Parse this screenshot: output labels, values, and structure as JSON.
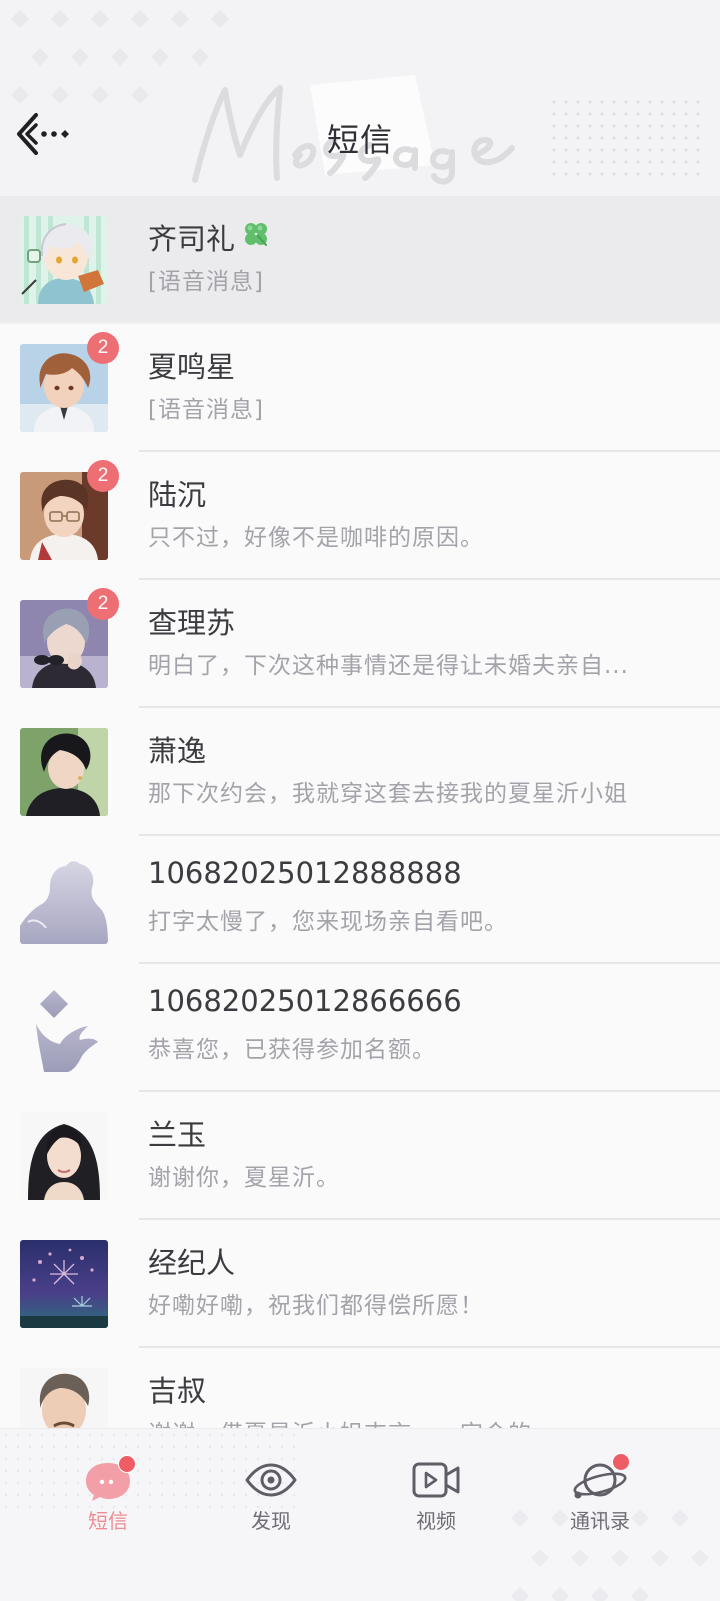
{
  "header": {
    "title": "短信"
  },
  "messages": [
    {
      "name": "齐司礼",
      "preview": "[语音消息]",
      "badge": "",
      "has_clover": true,
      "avatar": "qisili-avatar"
    },
    {
      "name": "夏鸣星",
      "preview": "[语音消息]",
      "badge": "2",
      "avatar": "xiamingxing-avatar"
    },
    {
      "name": "陆沉",
      "preview": "只不过，好像不是咖啡的原因。",
      "badge": "2",
      "avatar": "luchen-avatar"
    },
    {
      "name": "查理苏",
      "preview": "明白了，下次这种事情还是得让未婚夫亲自...",
      "badge": "2",
      "avatar": "chalisu-avatar"
    },
    {
      "name": "萧逸",
      "preview": "那下次约会，我就穿这套去接我的夏星沂小姐",
      "badge": "",
      "avatar": "xiaoyi-avatar"
    },
    {
      "name": "10682025012888888",
      "preview": "打字太慢了，您来现场亲自看吧。",
      "badge": "",
      "avatar": "default-contact-avatar"
    },
    {
      "name": "10682025012866666",
      "preview": "恭喜您，已获得参加名额。",
      "badge": "",
      "avatar": "system-contact-avatar"
    },
    {
      "name": "兰玉",
      "preview": "谢谢你，夏星沂。",
      "badge": "",
      "avatar": "lanyu-avatar"
    },
    {
      "name": "经纪人",
      "preview": "好嘞好嘞，祝我们都得偿所愿！",
      "badge": "",
      "avatar": "agent-avatar"
    },
    {
      "name": "吉叔",
      "preview": "谢谢，借夏星沂小姐吉言，一定会的。",
      "badge": "",
      "avatar": "jishu-avatar"
    }
  ],
  "tabs": [
    {
      "label": "短信",
      "icon": "message-icon",
      "active": true,
      "has_dot": true
    },
    {
      "label": "发现",
      "icon": "eye-icon",
      "active": false,
      "has_dot": false
    },
    {
      "label": "视频",
      "icon": "video-icon",
      "active": false,
      "has_dot": false
    },
    {
      "label": "通讯录",
      "icon": "planet-icon",
      "active": false,
      "has_dot": true
    }
  ],
  "colors": {
    "badge": "#ee6f73",
    "active_tab": "#ef8c93",
    "notification_dot": "#ee5c66"
  }
}
